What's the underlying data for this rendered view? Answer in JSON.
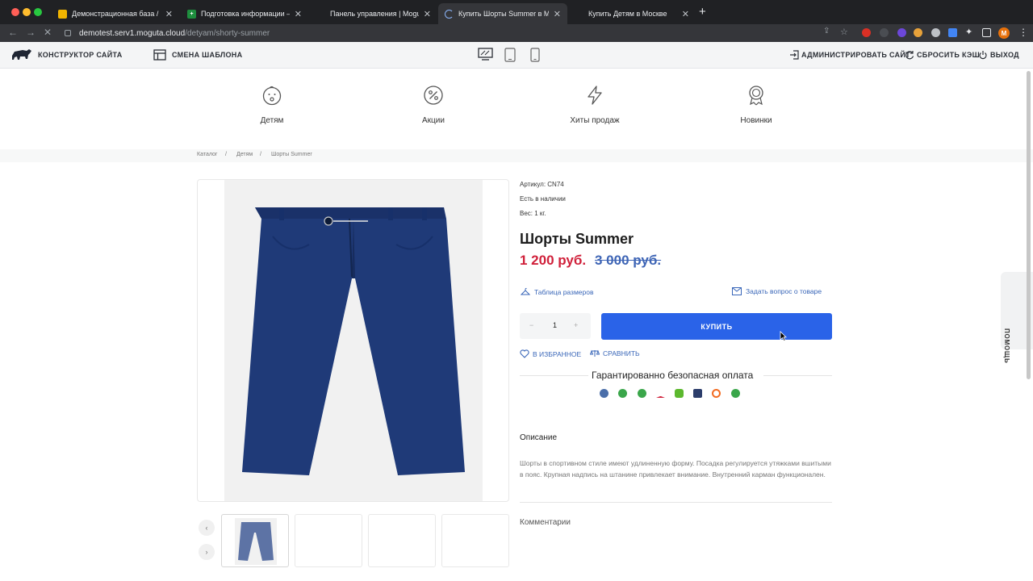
{
  "browser": {
    "tabs": [
      {
        "title": "Демонстрационная база / Уп",
        "favicon_color": "#f0b400",
        "active": false
      },
      {
        "title": "Подготовка информации – Go",
        "favicon_color": "#1e8e3e",
        "active": false
      },
      {
        "title": "Панель управления | Moguta",
        "favicon_color": "#202124",
        "active": false
      },
      {
        "title": "Купить Шорты Summer в Мос",
        "favicon_color": "#8ab4f8",
        "active": true
      },
      {
        "title": "Купить Детям в Москве",
        "favicon_color": "#202124",
        "active": false
      }
    ],
    "url_host": "demotest.serv1.moguta.cloud",
    "url_path": "/detyam/shorty-summer",
    "profile_initial": "M"
  },
  "toolbar": {
    "site_builder": "Конструктор сайта",
    "change_template": "Смена шаблона",
    "admin": "Администрировать сайт",
    "reset_cache": "Сбросить кэш",
    "logout": "Выход"
  },
  "categories": [
    "Детям",
    "Акции",
    "Хиты продаж",
    "Новинки"
  ],
  "breadcrumbs": [
    "Каталог",
    "/",
    "Детям",
    "/",
    "Шорты Summer"
  ],
  "product": {
    "sku": "Артикул: CN74",
    "stock": "Есть в наличии",
    "weight": "Вес: 1 кг.",
    "title": "Шорты Summer",
    "price": "1 200 руб.",
    "old_price": "3 000 руб.",
    "size_table": "Таблица размеров",
    "ask_question": "Задать вопрос о товаре",
    "qty_minus": "−",
    "qty_value": "1",
    "qty_plus": "+",
    "buy": "КУПИТЬ",
    "favorites": "В избранное",
    "compare": "Сравнить",
    "payment_title": "Гарантированно безопасная оплата",
    "description_title": "Описание",
    "description": "Шорты в спортивном стиле имеют удлиненную форму. Посадка регулируется утяжками вшитыми в пояс. Крупная надпись на штанине привлекает внимание. Внутренний карман функционален.",
    "comments_title": "Комментарии"
  },
  "help": "ПОМОЩЬ",
  "colors": {
    "accent": "#2a63e8",
    "price": "#d0203a",
    "old_price": "#3d64b5",
    "link": "#3966b8",
    "shorts": "#1f3a78"
  },
  "payment_icon_colors": [
    "#4a6ea9",
    "#3aa64a",
    "#3aa64a",
    "#d0203a",
    "#5cb82e",
    "#2c3d6b",
    "#f26b21",
    "#3aa64a"
  ]
}
